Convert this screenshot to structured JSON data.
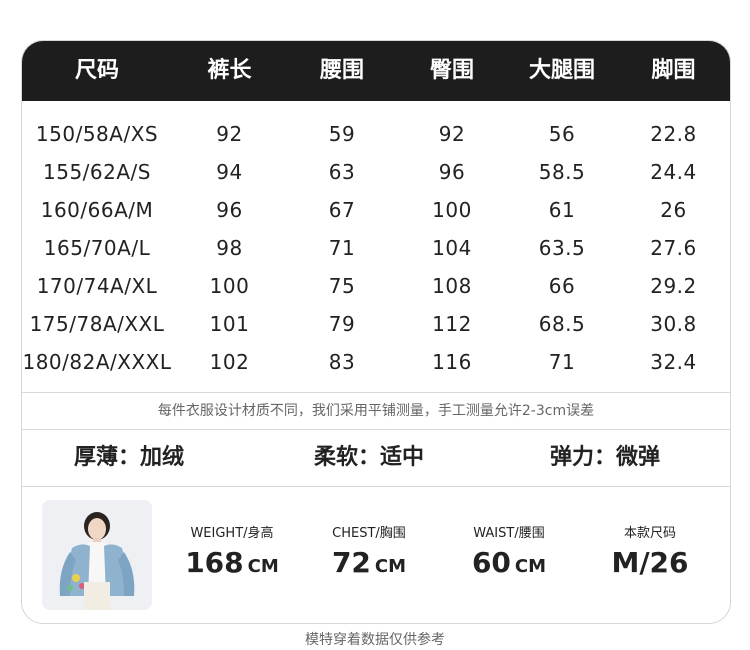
{
  "table": {
    "headers": [
      "尺码",
      "裤长",
      "腰围",
      "臀围",
      "大腿围",
      "脚围"
    ],
    "rows": [
      [
        "150/58A/XS",
        "92",
        "59",
        "92",
        "56",
        "22.8"
      ],
      [
        "155/62A/S",
        "94",
        "63",
        "96",
        "58.5",
        "24.4"
      ],
      [
        "160/66A/M",
        "96",
        "67",
        "100",
        "61",
        "26"
      ],
      [
        "165/70A/L",
        "98",
        "71",
        "104",
        "63.5",
        "27.6"
      ],
      [
        "170/74A/XL",
        "100",
        "75",
        "108",
        "66",
        "29.2"
      ],
      [
        "175/78A/XXL",
        "101",
        "79",
        "112",
        "68.5",
        "30.8"
      ],
      [
        "180/82A/XXXL",
        "102",
        "83",
        "116",
        "71",
        "32.4"
      ]
    ]
  },
  "note": "每件衣服设计材质不同，我们采用平铺测量，手工测量允许2-3cm误差",
  "attributes": {
    "thickness": "厚薄：加绒",
    "softness": "柔软：适中",
    "elasticity": "弹力：微弹"
  },
  "model": {
    "height_label": "WEIGHT/身高",
    "height_value": "168",
    "height_unit": "CM",
    "chest_label": "CHEST/胸围",
    "chest_value": "72",
    "chest_unit": "CM",
    "waist_label": "WAIST/腰围",
    "waist_value": "60",
    "waist_unit": "CM",
    "size_label": "本款尺码",
    "size_value": "M/26"
  },
  "footer": "模特穿着数据仅供参考",
  "colors": {
    "header_bg": "#1d1d1d",
    "header_text": "#ffffff",
    "border": "#d6d6d6"
  }
}
